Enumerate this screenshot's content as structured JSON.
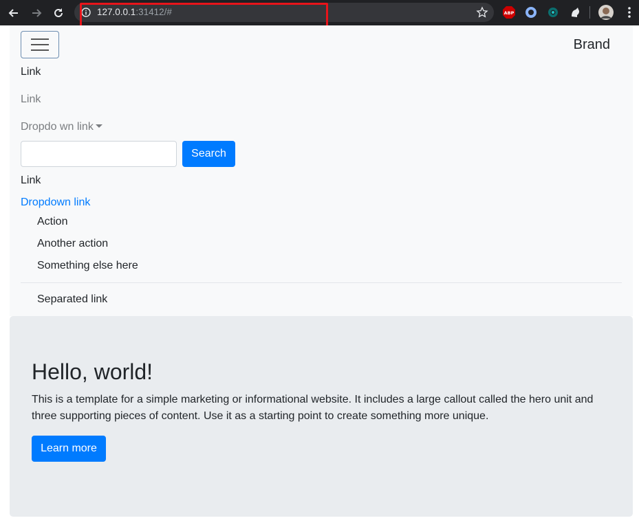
{
  "browser": {
    "url_host": "127.0.0.1",
    "url_rest": ":31412/#",
    "extensions": [
      "abp-icon",
      "extension-icon",
      "extension-icon",
      "extension-icon"
    ],
    "highlight_color": "#e8141a"
  },
  "navbar": {
    "brand": "Brand",
    "link1": "Link",
    "link2": "Link",
    "dropdown1": "Dropdo wn link",
    "search_button": "Search",
    "search_value": "",
    "link3": "Link",
    "dropdown2": "Dropdown link",
    "dropdown_items": [
      "Action",
      "Another action",
      "Something else here"
    ],
    "separated_link": "Separated link"
  },
  "jumbotron": {
    "title": "Hello, world!",
    "text": "This is a template for a simple marketing or informational website. It includes a large callout called the hero unit and three supporting pieces of content. Use it as a starting point to create something more unique.",
    "button": "Learn more"
  },
  "colors": {
    "primary": "#007bff",
    "navbar_bg": "#f8f9fa",
    "jumbotron_bg": "#e9ecef"
  }
}
